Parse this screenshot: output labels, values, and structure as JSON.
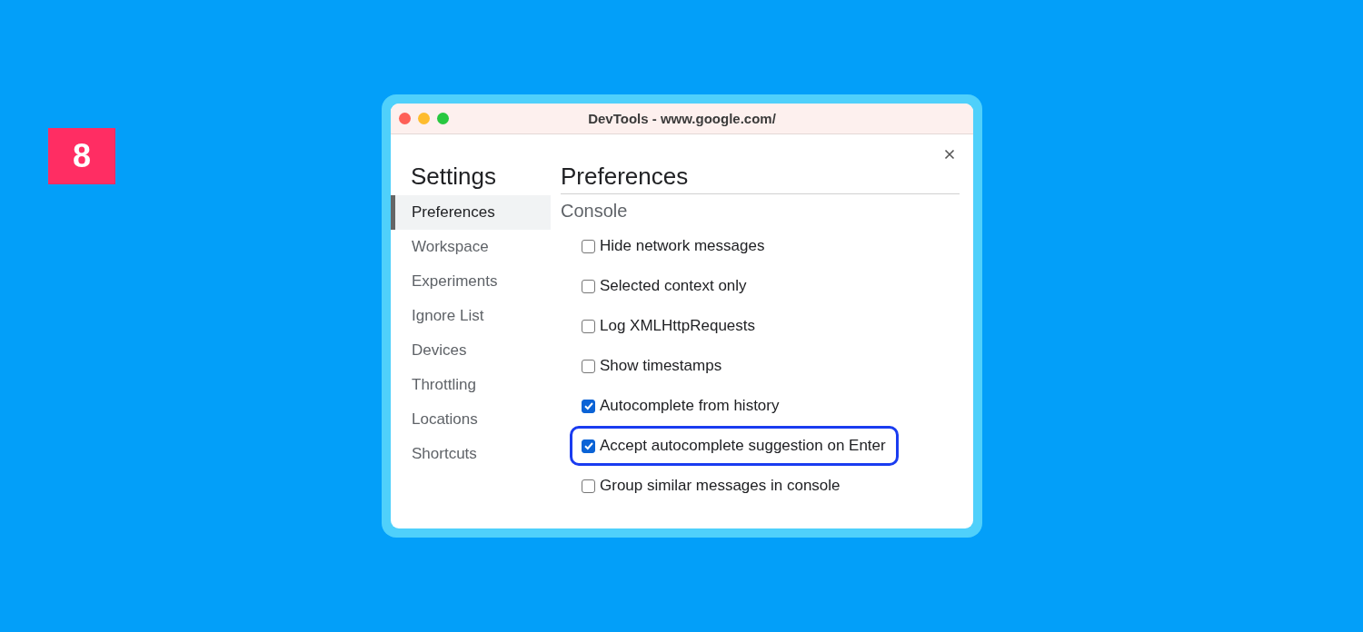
{
  "step_badge": "8",
  "window": {
    "title": "DevTools - www.google.com/"
  },
  "sidebar": {
    "title": "Settings",
    "items": [
      {
        "label": "Preferences",
        "selected": true
      },
      {
        "label": "Workspace",
        "selected": false
      },
      {
        "label": "Experiments",
        "selected": false
      },
      {
        "label": "Ignore List",
        "selected": false
      },
      {
        "label": "Devices",
        "selected": false
      },
      {
        "label": "Throttling",
        "selected": false
      },
      {
        "label": "Locations",
        "selected": false
      },
      {
        "label": "Shortcuts",
        "selected": false
      }
    ]
  },
  "main": {
    "title": "Preferences",
    "section": "Console",
    "options": [
      {
        "label": "Hide network messages",
        "checked": false,
        "highlighted": false
      },
      {
        "label": "Selected context only",
        "checked": false,
        "highlighted": false
      },
      {
        "label": "Log XMLHttpRequests",
        "checked": false,
        "highlighted": false
      },
      {
        "label": "Show timestamps",
        "checked": false,
        "highlighted": false
      },
      {
        "label": "Autocomplete from history",
        "checked": true,
        "highlighted": false
      },
      {
        "label": "Accept autocomplete suggestion on Enter",
        "checked": true,
        "highlighted": true
      },
      {
        "label": "Group similar messages in console",
        "checked": false,
        "highlighted": false
      }
    ]
  }
}
